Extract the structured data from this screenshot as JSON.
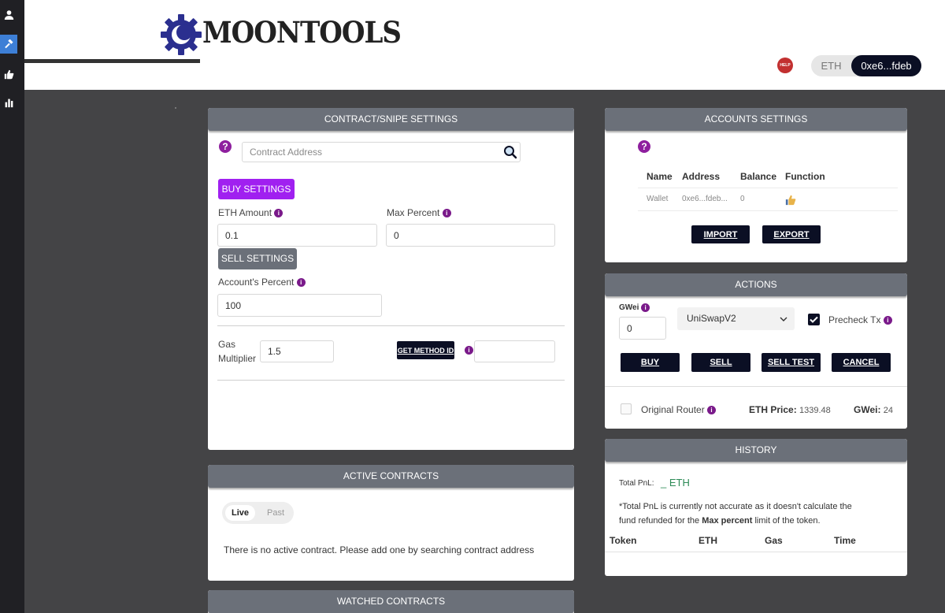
{
  "sidebar": {
    "items": [
      {
        "name": "user-icon"
      },
      {
        "name": "hammer-icon"
      },
      {
        "name": "thumbs-up-icon"
      },
      {
        "name": "bar-chart-icon"
      }
    ]
  },
  "header": {
    "logo_text": "MOONTOOLS",
    "help_badge": "HELP",
    "network": "ETH",
    "wallet_short": "0xe6...fdeb"
  },
  "contract": {
    "title": "CONTRACT/SNIPE SETTINGS",
    "address_placeholder": "Contract Address",
    "buy_settings_label": "BUY SETTINGS",
    "eth_amount_label": "ETH Amount",
    "eth_amount_value": "0.1",
    "max_percent_label": "Max Percent",
    "max_percent_value": "0",
    "sell_settings_label": "SELL SETTINGS",
    "account_percent_label": "Account's Percent",
    "account_percent_value": "100",
    "gas_label_1": "Gas",
    "gas_label_2": "Multiplier",
    "gas_value": "1.5",
    "get_method_label": "GET METHOD ID",
    "method_id_value": ""
  },
  "active": {
    "title": "ACTIVE CONTRACTS",
    "tab_live": "Live",
    "tab_past": "Past",
    "empty_text": "There is no active contract. Please add one by searching contract address"
  },
  "watched": {
    "title": "WATCHED CONTRACTS"
  },
  "accounts": {
    "title": "ACCOUNTS SETTINGS",
    "columns": [
      "Name",
      "Address",
      "Balance",
      "Function"
    ],
    "rows": [
      {
        "name": "Wallet",
        "address": "0xe6...fdeb...",
        "balance": "0"
      }
    ],
    "import_label": "IMPORT",
    "export_label": "EXPORT"
  },
  "actions": {
    "title": "ACTIONS",
    "gwei_label": "GWei",
    "gwei_value": "0",
    "router_selected": "UniSwapV2",
    "precheck_label": "Precheck Tx",
    "buy_label": "BUY",
    "sell_label": "SELL",
    "sell_test_label": "SELL TEST",
    "cancel_label": "CANCEL",
    "original_router_label": "Original Router",
    "eth_price_label": "ETH Price:",
    "eth_price_value": "1339.48",
    "gwei_status_label": "GWei:",
    "gwei_status_value": "24"
  },
  "history": {
    "title": "HISTORY",
    "total_pnl_label": "Total PnL:",
    "total_pnl_value": "_ ETH",
    "note_1": "*Total PnL is currently not accurate as it doesn't calculate the",
    "note_2a": "fund refunded for the ",
    "note_2b": "Max percent",
    "note_2c": " limit of the token.",
    "columns": [
      "Token",
      "ETH",
      "Gas",
      "Time"
    ]
  },
  "colors": {
    "accent_purple": "#a020f0",
    "dark_navy": "#0b0f24",
    "panel_header": "#6b7079",
    "pnl_green": "#2e8b57"
  }
}
